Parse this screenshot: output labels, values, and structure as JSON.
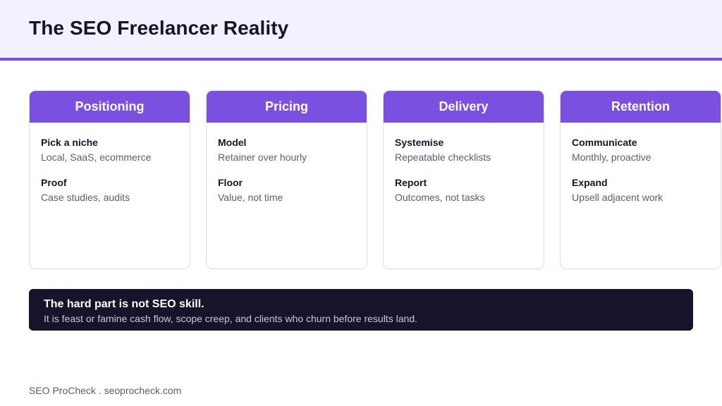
{
  "header": {
    "title": "The SEO Freelancer Reality"
  },
  "cards": [
    {
      "title": "Positioning",
      "items": [
        {
          "label": "Pick a niche",
          "text": "Local, SaaS, ecommerce"
        },
        {
          "label": "Proof",
          "text": "Case studies, audits"
        }
      ]
    },
    {
      "title": "Pricing",
      "items": [
        {
          "label": "Model",
          "text": "Retainer over hourly"
        },
        {
          "label": "Floor",
          "text": "Value, not time"
        }
      ]
    },
    {
      "title": "Delivery",
      "items": [
        {
          "label": "Systemise",
          "text": "Repeatable checklists"
        },
        {
          "label": "Report",
          "text": "Outcomes, not tasks"
        }
      ]
    },
    {
      "title": "Retention",
      "items": [
        {
          "label": "Communicate",
          "text": "Monthly, proactive"
        },
        {
          "label": "Expand",
          "text": "Upsell adjacent work"
        }
      ]
    }
  ],
  "banner": {
    "title": "The hard part is not SEO skill.",
    "text": "It is feast or famine cash flow, scope creep, and clients who churn before results land."
  },
  "footer": {
    "text": "SEO ProCheck . seoprocheck.com"
  },
  "colors": {
    "accent": "#7b4fe0",
    "dark": "#16142a",
    "header_bg": "#f3f1fd"
  }
}
